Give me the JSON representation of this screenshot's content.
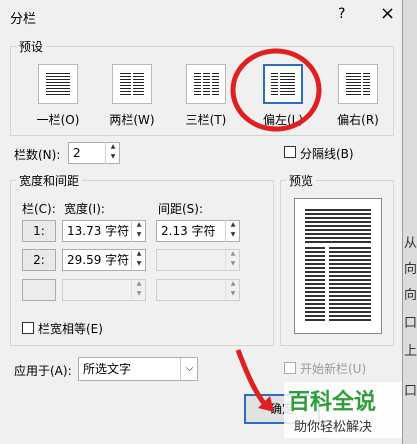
{
  "dialog": {
    "title": "分栏",
    "help": "?",
    "close": "×"
  },
  "presets": {
    "group_label": "预设",
    "items": [
      {
        "label": "一栏(O)"
      },
      {
        "label": "两栏(W)"
      },
      {
        "label": "三栏(T)"
      },
      {
        "label": "偏左(L)",
        "selected": true
      },
      {
        "label": "偏右(R)"
      }
    ]
  },
  "column_count": {
    "label": "栏数(N):",
    "value": "2"
  },
  "divider": {
    "label": "分隔线(B)",
    "checked": false
  },
  "width_spacing": {
    "group_label": "宽度和间距",
    "col_header": "栏(C):",
    "width_header": "宽度(I):",
    "spacing_header": "间距(S):",
    "rows": [
      {
        "num": "1:",
        "width": "13.73 字符",
        "spacing": "2.13 字符"
      },
      {
        "num": "2:",
        "width": "29.59 字符",
        "spacing": ""
      },
      {
        "num": "",
        "width": "",
        "spacing": ""
      }
    ],
    "equal_width": {
      "label": "栏宽相等(E)",
      "checked": false
    }
  },
  "preview": {
    "label": "预览"
  },
  "apply_to": {
    "label": "应用于(A):",
    "value": "所选文字"
  },
  "new_column": {
    "label": "开始新栏(U)",
    "checked": false
  },
  "ok_button": "确定",
  "watermark": {
    "title": "百科全说",
    "subtitle": "助你轻松解决"
  },
  "background_chars": [
    "从",
    "向",
    "向",
    "口",
    "上",
    "口"
  ],
  "colors": {
    "accent": "#2b6cc4",
    "highlight": "#e02020",
    "watermark_green": "#2e9e3a"
  }
}
